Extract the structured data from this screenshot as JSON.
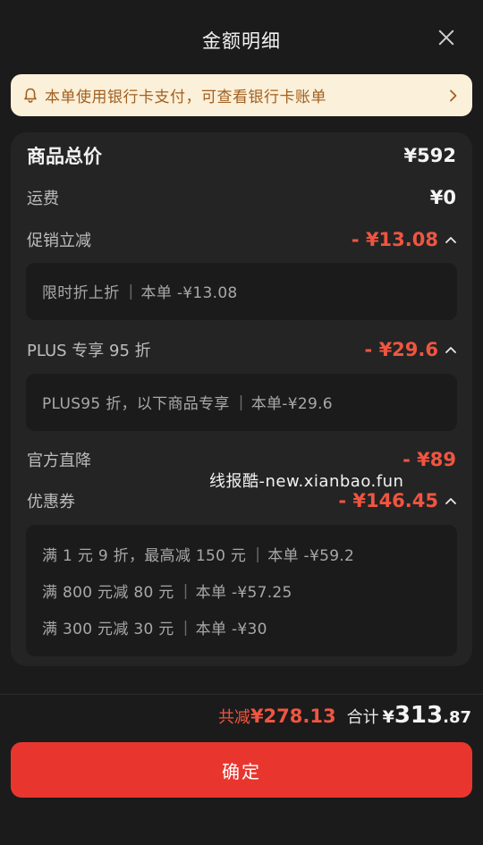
{
  "header": {
    "title": "金额明细",
    "close_icon": "close-icon"
  },
  "notice": {
    "text": "本单使用银行卡支付，可查看银行卡账单",
    "icon": "bell-icon",
    "chevron": "chevron-right-icon"
  },
  "colors": {
    "accent_red": "#f05540",
    "button_red": "#e8362f",
    "notice_bg": "#fbf0d9",
    "notice_text": "#a25f1f"
  },
  "breakdown": {
    "goods_total": {
      "label": "商品总价",
      "value": "¥592"
    },
    "shipping": {
      "label": "运费",
      "value": "¥0"
    },
    "promotion": {
      "label": "促销立减",
      "value": "- ¥13.08",
      "details": [
        {
          "name": "限时折上折",
          "amount": "本单 -¥13.08"
        }
      ]
    },
    "plus": {
      "label": "PLUS 专享 95 折",
      "value": "- ¥29.6",
      "details": [
        {
          "name": "PLUS95 折，以下商品专享",
          "amount": "本单-¥29.6"
        }
      ]
    },
    "direct_drop": {
      "label": "官方直降",
      "value": "- ¥89"
    },
    "coupon": {
      "label": "优惠券",
      "value": "- ¥146.45",
      "details": [
        {
          "name": "满 1 元 9 折，最高减 150 元",
          "amount": "本单 -¥59.2"
        },
        {
          "name": "满 800 元减 80 元",
          "amount": "本单 -¥57.25"
        },
        {
          "name": "满 300 元减 30 元",
          "amount": "本单 -¥30"
        }
      ]
    }
  },
  "watermark": "线报酷-new.xianbao.fun",
  "footer": {
    "saved_label": "共减",
    "saved_value": "¥278.13",
    "total_label": "合计",
    "total_currency": "¥",
    "total_int": "313",
    "total_dec": ".87",
    "confirm_label": "确定"
  }
}
